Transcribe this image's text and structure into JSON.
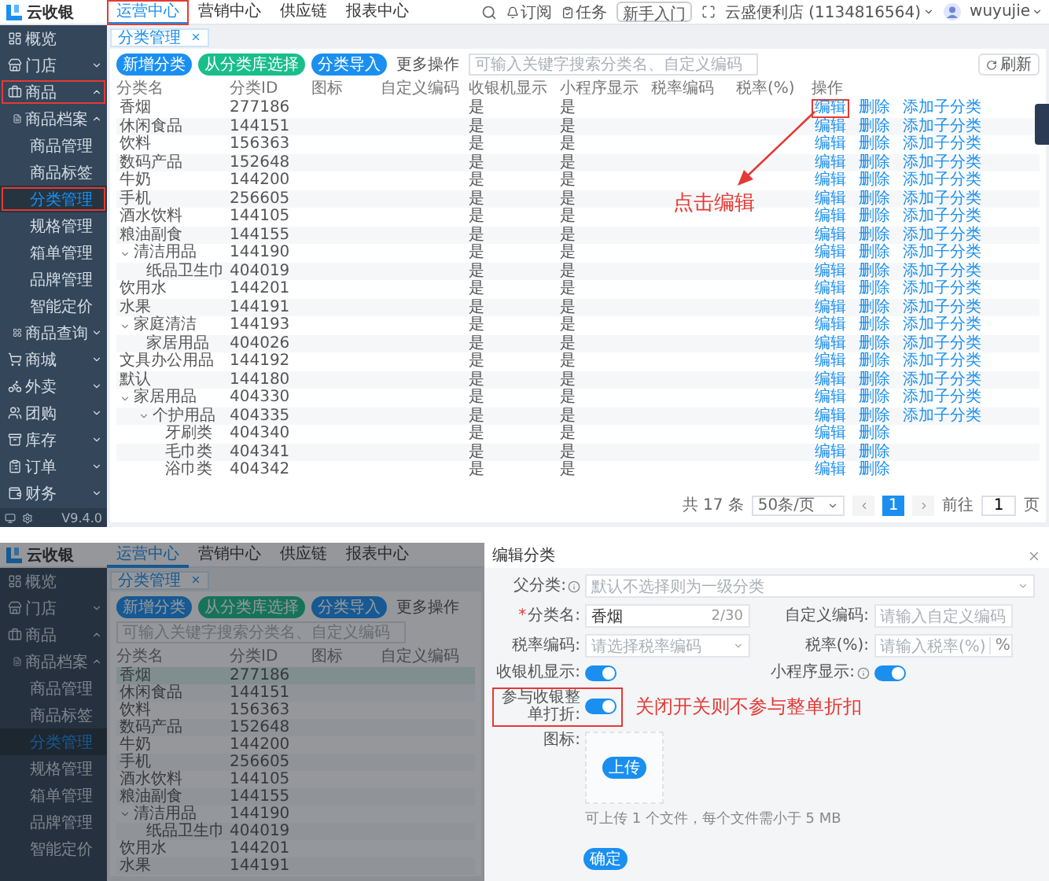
{
  "top_screen": {
    "header": {
      "logo": "云收银",
      "nav": [
        {
          "label": "运营中心",
          "selected": true,
          "annotated": true
        },
        {
          "label": "营销中心",
          "selected": false,
          "annotated": false
        },
        {
          "label": "供应链",
          "selected": false,
          "annotated": false
        },
        {
          "label": "报表中心",
          "selected": false,
          "annotated": false
        }
      ],
      "tools": [
        "订阅",
        "任务"
      ],
      "guide_button": "新手入门",
      "store": "云盛便利店 (1134816564)",
      "user": "wuyujie"
    },
    "sidebar": {
      "items": [
        {
          "label": "概览",
          "annotated": false
        },
        {
          "label": "门店",
          "expanded": false,
          "annotated": false
        },
        {
          "label": "商品",
          "expanded": true,
          "annotated": true,
          "children": [
            {
              "label": "商品档案",
              "expanded": true,
              "annotated": false,
              "children": [
                {
                  "label": "商品管理",
                  "selected": false,
                  "annotated": false
                },
                {
                  "label": "商品标签",
                  "selected": false,
                  "annotated": false
                },
                {
                  "label": "分类管理",
                  "selected": true,
                  "annotated": true
                },
                {
                  "label": "规格管理",
                  "selected": false,
                  "annotated": false
                },
                {
                  "label": "箱单管理",
                  "selected": false,
                  "annotated": false
                },
                {
                  "label": "品牌管理",
                  "selected": false,
                  "annotated": false
                },
                {
                  "label": "智能定价",
                  "selected": false,
                  "annotated": false
                }
              ]
            },
            {
              "label": "商品查询",
              "expanded": false,
              "annotated": false
            }
          ]
        },
        {
          "label": "商城",
          "expanded": false,
          "annotated": false
        },
        {
          "label": "外卖",
          "expanded": false,
          "annotated": false
        },
        {
          "label": "团购",
          "expanded": false,
          "annotated": false
        },
        {
          "label": "库存",
          "expanded": false,
          "annotated": false
        },
        {
          "label": "订单",
          "expanded": false,
          "annotated": false
        },
        {
          "label": "财务",
          "expanded": false,
          "annotated": false
        }
      ],
      "version": "V9.4.0"
    },
    "tabs": [
      {
        "label": "分类管理",
        "selected": true
      }
    ],
    "toolbar": {
      "buttons": [
        {
          "label": "新增分类",
          "kind": "primary"
        },
        {
          "label": "从分类库选择",
          "kind": "success"
        },
        {
          "label": "分类导入",
          "kind": "primary"
        }
      ],
      "more": "更多操作",
      "search_placeholder": "可输入关键字搜索分类名、自定义编码",
      "refresh": "刷新"
    },
    "table": {
      "columns": [
        "分类名",
        "分类ID",
        "图标",
        "自定义编码",
        "收银机显示",
        "小程序显示",
        "税率编码",
        "税率(%)",
        "操作"
      ],
      "rows": [
        {
          "name": "香烟",
          "id": "277186",
          "cashier": "是",
          "miniapp": "是",
          "actions": [
            "编辑",
            "删除",
            "添加子分类"
          ],
          "marked": true
        },
        {
          "name": "休闲食品",
          "id": "144151",
          "cashier": "是",
          "miniapp": "是",
          "actions": [
            "编辑",
            "删除",
            "添加子分类"
          ],
          "marked": false
        },
        {
          "name": "饮料",
          "id": "156363",
          "cashier": "是",
          "miniapp": "是",
          "actions": [
            "编辑",
            "删除",
            "添加子分类"
          ],
          "marked": false
        },
        {
          "name": "数码产品",
          "id": "152648",
          "cashier": "是",
          "miniapp": "是",
          "actions": [
            "编辑",
            "删除",
            "添加子分类"
          ],
          "marked": false
        },
        {
          "name": "牛奶",
          "id": "144200",
          "cashier": "是",
          "miniapp": "是",
          "actions": [
            "编辑",
            "删除",
            "添加子分类"
          ],
          "marked": false
        },
        {
          "name": "手机",
          "id": "256605",
          "cashier": "是",
          "miniapp": "是",
          "actions": [
            "编辑",
            "删除",
            "添加子分类"
          ],
          "marked": false
        },
        {
          "name": "酒水饮料",
          "id": "144105",
          "cashier": "是",
          "miniapp": "是",
          "actions": [
            "编辑",
            "删除",
            "添加子分类"
          ],
          "marked": false
        },
        {
          "name": "粮油副食",
          "id": "144155",
          "cashier": "是",
          "miniapp": "是",
          "actions": [
            "编辑",
            "删除",
            "添加子分类"
          ],
          "marked": false
        },
        {
          "name": "清洁用品",
          "id": "144190",
          "cashier": "是",
          "miniapp": "是",
          "actions": [
            "编辑",
            "删除",
            "添加子分类"
          ],
          "marked": false,
          "expanded": true,
          "children": [
            {
              "name": "纸品卫生巾",
              "id": "404019",
              "cashier": "是",
              "miniapp": "是",
              "actions": [
                "编辑",
                "删除",
                "添加子分类"
              ],
              "marked": false
            }
          ]
        },
        {
          "name": "饮用水",
          "id": "144201",
          "cashier": "是",
          "miniapp": "是",
          "actions": [
            "编辑",
            "删除",
            "添加子分类"
          ],
          "marked": false
        },
        {
          "name": "水果",
          "id": "144191",
          "cashier": "是",
          "miniapp": "是",
          "actions": [
            "编辑",
            "删除",
            "添加子分类"
          ],
          "marked": false
        },
        {
          "name": "家庭清洁",
          "id": "144193",
          "cashier": "是",
          "miniapp": "是",
          "actions": [
            "编辑",
            "删除",
            "添加子分类"
          ],
          "marked": false,
          "expanded": true,
          "children": [
            {
              "name": "家居用品",
              "id": "404026",
              "cashier": "是",
              "miniapp": "是",
              "actions": [
                "编辑",
                "删除",
                "添加子分类"
              ],
              "marked": false
            }
          ]
        },
        {
          "name": "文具办公用品",
          "id": "144192",
          "cashier": "是",
          "miniapp": "是",
          "actions": [
            "编辑",
            "删除",
            "添加子分类"
          ],
          "marked": false
        },
        {
          "name": "默认",
          "id": "144180",
          "cashier": "是",
          "miniapp": "是",
          "actions": [
            "编辑",
            "删除",
            "添加子分类"
          ],
          "marked": false
        },
        {
          "name": "家居用品",
          "id": "404330",
          "cashier": "是",
          "miniapp": "是",
          "actions": [
            "编辑",
            "删除",
            "添加子分类"
          ],
          "marked": false,
          "expanded": true,
          "children": [
            {
              "name": "个护用品",
              "id": "404335",
              "cashier": "是",
              "miniapp": "是",
              "actions": [
                "编辑",
                "删除",
                "添加子分类"
              ],
              "marked": false,
              "expanded": true,
              "children": [
                {
                  "name": "牙刷类",
                  "id": "404340",
                  "cashier": "是",
                  "miniapp": "是",
                  "actions": [
                    "编辑",
                    "删除"
                  ],
                  "marked": false
                },
                {
                  "name": "毛巾类",
                  "id": "404341",
                  "cashier": "是",
                  "miniapp": "是",
                  "actions": [
                    "编辑",
                    "删除"
                  ],
                  "marked": false
                },
                {
                  "name": "浴巾类",
                  "id": "404342",
                  "cashier": "是",
                  "miniapp": "是",
                  "actions": [
                    "编辑",
                    "删除"
                  ],
                  "marked": false
                }
              ]
            }
          ]
        }
      ]
    },
    "pagination": {
      "total": "共 17 条",
      "page_size": "50条/页",
      "pages": [
        {
          "label": "1",
          "selected": true
        }
      ],
      "goto": "前往",
      "page_input": "1",
      "page_unit": "页"
    },
    "annotation": {
      "text": "点击编辑"
    }
  },
  "bottom_screen": {
    "header": {
      "logo": "云收银",
      "nav": [
        {
          "label": "运营中心",
          "selected": true,
          "annotated": false
        },
        {
          "label": "营销中心",
          "selected": false,
          "annotated": false
        },
        {
          "label": "供应链",
          "selected": false,
          "annotated": false
        },
        {
          "label": "报表中心",
          "selected": false,
          "annotated": false
        }
      ]
    },
    "sidebar": {
      "items": [
        {
          "label": "概览",
          "annotated": false
        },
        {
          "label": "门店",
          "expanded": false,
          "annotated": false
        },
        {
          "label": "商品",
          "expanded": true,
          "annotated": false,
          "children": [
            {
              "label": "商品档案",
              "expanded": true,
              "annotated": false,
              "children": [
                {
                  "label": "商品管理",
                  "selected": false,
                  "annotated": false
                },
                {
                  "label": "商品标签",
                  "selected": false,
                  "annotated": false
                },
                {
                  "label": "分类管理",
                  "selected": true,
                  "annotated": false
                },
                {
                  "label": "规格管理",
                  "selected": false,
                  "annotated": false
                },
                {
                  "label": "箱单管理",
                  "selected": false,
                  "annotated": false
                },
                {
                  "label": "品牌管理",
                  "selected": false,
                  "annotated": false
                },
                {
                  "label": "智能定价",
                  "selected": false,
                  "annotated": false
                }
              ]
            }
          ]
        }
      ]
    },
    "tabs": [
      {
        "label": "分类管理",
        "selected": true
      }
    ],
    "toolbar": {
      "buttons": [
        {
          "label": "新增分类",
          "kind": "primary"
        },
        {
          "label": "从分类库选择",
          "kind": "success"
        },
        {
          "label": "分类导入",
          "kind": "primary"
        }
      ],
      "more": "更多操作",
      "search_placeholder": "可输入关键字搜索分类名、自定义编码"
    },
    "table": {
      "columns": [
        "分类名",
        "分类ID",
        "图标",
        "自定义编码"
      ],
      "rows": [
        {
          "name": "香烟",
          "id": "277186",
          "selected": true
        },
        {
          "name": "休闲食品",
          "id": "144151",
          "selected": false
        },
        {
          "name": "饮料",
          "id": "156363",
          "selected": false
        },
        {
          "name": "数码产品",
          "id": "152648",
          "selected": false
        },
        {
          "name": "牛奶",
          "id": "144200",
          "selected": false
        },
        {
          "name": "手机",
          "id": "256605",
          "selected": false
        },
        {
          "name": "酒水饮料",
          "id": "144105",
          "selected": false
        },
        {
          "name": "粮油副食",
          "id": "144155",
          "selected": false
        },
        {
          "name": "清洁用品",
          "id": "144190",
          "selected": false,
          "expanded": true,
          "children": [
            {
              "name": "纸品卫生巾",
              "id": "404019",
              "selected": false
            }
          ]
        },
        {
          "name": "饮用水",
          "id": "144201",
          "selected": false
        },
        {
          "name": "水果",
          "id": "144191",
          "selected": false
        }
      ]
    }
  },
  "dialog": {
    "title": "编辑分类",
    "rows": [
      [
        {
          "kind": "select",
          "label": "父分类:",
          "info": true,
          "placeholder": "默认不选择则为一级分类"
        }
      ],
      [
        {
          "kind": "text",
          "label": "分类名:",
          "required_mark": "*",
          "value": "香烟",
          "counter": "2/30"
        },
        {
          "kind": "text",
          "label": "自定义编码:",
          "placeholder": "请输入自定义编码"
        }
      ],
      [
        {
          "kind": "select",
          "label": "税率编码:",
          "placeholder": "请选择税率编码"
        },
        {
          "kind": "text",
          "label": "税率(%):",
          "placeholder": "请输入税率(%)",
          "suffix": "%"
        }
      ],
      [
        {
          "kind": "switch",
          "label": "收银机显示:",
          "on": true
        },
        {
          "kind": "switch",
          "label": "小程序显示:",
          "info": true,
          "on": true
        }
      ],
      [
        {
          "kind": "switch",
          "label": "参与收银整单打折:",
          "on": true,
          "annotated": true,
          "note": "关闭开关则不参与整单折扣"
        }
      ],
      [
        {
          "kind": "upload",
          "label": "图标:",
          "button": "上传",
          "hint": "可上传 1 个文件，每个文件需小于 5 MB"
        }
      ]
    ],
    "submit": "确定"
  }
}
